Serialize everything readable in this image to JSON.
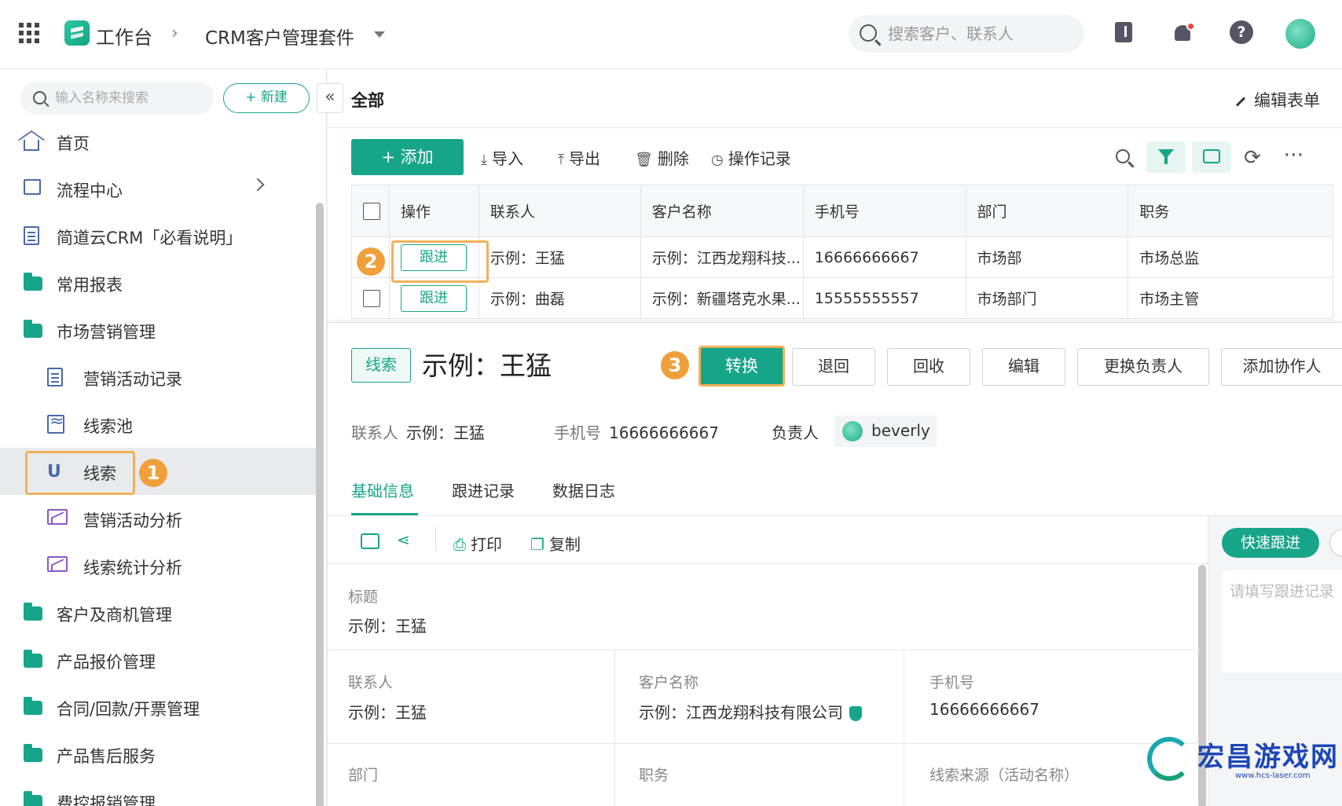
{
  "topbar": {
    "title": "工作台",
    "breadcrumb_sep": "›",
    "suite": "CRM客户管理套件",
    "search_placeholder": "搜索客户、联系人"
  },
  "sidebar": {
    "search_placeholder": "输入名称来搜索",
    "new_label": "+ 新建",
    "collapse_label": "«",
    "items": [
      {
        "label": "首页",
        "icon": "home-icon"
      },
      {
        "label": "流程中心",
        "icon": "flow-icon"
      },
      {
        "label": "简道云CRM「必看说明」",
        "icon": "doc-icon"
      },
      {
        "label": "常用报表",
        "icon": "folder-icon"
      },
      {
        "label": "市场营销管理",
        "icon": "folder-icon"
      },
      {
        "label": "营销活动记录",
        "icon": "doc-icon"
      },
      {
        "label": "线索池",
        "icon": "pool-icon"
      },
      {
        "label": "线索",
        "icon": "lead-icon"
      },
      {
        "label": "营销活动分析",
        "icon": "chart-icon"
      },
      {
        "label": "线索统计分析",
        "icon": "chart-icon"
      },
      {
        "label": "客户及商机管理",
        "icon": "folder-icon"
      },
      {
        "label": "产品报价管理",
        "icon": "folder-icon"
      },
      {
        "label": "合同/回款/开票管理",
        "icon": "folder-icon"
      },
      {
        "label": "产品售后服务",
        "icon": "folder-icon"
      },
      {
        "label": "费控报销管理",
        "icon": "folder-icon"
      }
    ],
    "badge_1": "1"
  },
  "main": {
    "title": "全部",
    "edit_form": "编辑表单",
    "toolbar": {
      "add": "+ 添加",
      "import": "导入",
      "export": "导出",
      "delete": "删除",
      "history": "操作记录"
    },
    "table": {
      "headers": [
        "操作",
        "联系人",
        "客户名称",
        "手机号",
        "部门",
        "职务"
      ],
      "rows": [
        {
          "action": "跟进",
          "contact": "示例：王猛",
          "customer": "示例：江西龙翔科技...",
          "phone": "16666666667",
          "dept": "市场部",
          "title": "市场总监"
        },
        {
          "action": "跟进",
          "contact": "示例：曲磊",
          "customer": "示例：新疆塔克水果...",
          "phone": "15555555557",
          "dept": "市场部门",
          "title": "市场主管"
        }
      ]
    },
    "badge_2": "2"
  },
  "detail": {
    "tag": "线索",
    "title": "示例：王猛",
    "badge_3": "3",
    "actions": {
      "convert": "转换",
      "return": "退回",
      "recycle": "回收",
      "edit": "编辑",
      "change_owner": "更换负责人",
      "add_collab": "添加协作人"
    },
    "meta": {
      "contact_key": "联系人",
      "contact_val": "示例：王猛",
      "phone_key": "手机号",
      "phone_val": "16666666667",
      "owner_key": "负责人",
      "owner_val": "beverly"
    },
    "tabs": [
      "基础信息",
      "跟进记录",
      "数据日志"
    ],
    "subtools": {
      "print": "打印",
      "copy": "复制"
    },
    "quick_follow": "快速跟进",
    "follow_placeholder": "请填写跟进记录",
    "fields": {
      "title_label": "标题",
      "title_value": "示例：王猛",
      "contact_label": "联系人",
      "contact_value": "示例：王猛",
      "customer_label": "客户名称",
      "customer_value": "示例：江西龙翔科技有限公司",
      "phone_label": "手机号",
      "phone_value": "16666666667",
      "dept_label": "部门",
      "job_label": "职务",
      "source_label": "线索来源（活动名称）"
    }
  },
  "watermark": {
    "text": "宏昌游戏网",
    "url": "www.hcs-laser.com"
  }
}
